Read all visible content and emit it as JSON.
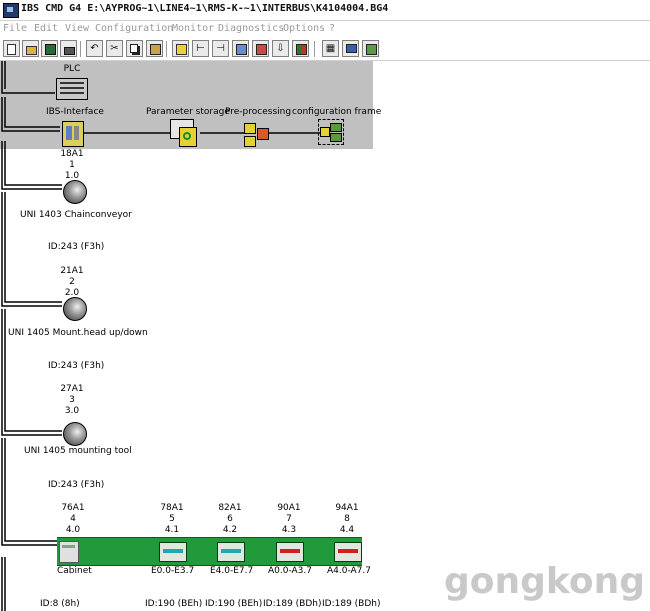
{
  "window": {
    "title": "IBS CMD G4 E:\\AYPROG~1\\LINE4~1\\RMS-K-~1\\INTERBUS\\K4104004.BG4"
  },
  "menu": [
    "File",
    "Edit",
    "View",
    "Configuration",
    "Monitor",
    "Diagnostics",
    "Options",
    "?"
  ],
  "toolbar": {
    "buttons": [
      "new-file-icon",
      "open-folder-icon",
      "save-icon",
      "print-icon",
      "undo-icon",
      "cut-icon",
      "copy-icon",
      "paste-icon",
      "bus-connect-icon",
      "add-device-icon",
      "add-branch-icon",
      "replace-icon",
      "swap-icon",
      "download-icon",
      "signal-icon",
      "table-icon",
      "monitor-icon",
      "tree-icon"
    ]
  },
  "diagram": {
    "plc_label": "PLC",
    "interface_label": "IBS-Interface",
    "param_storage_label": "Parameter storage",
    "preprocessing_label": "Pre-processing",
    "config_frame_label": "configuration frame",
    "devices": [
      {
        "addr": "18A1",
        "num": "1",
        "pos": "1.0",
        "name": "UNI 1403 Chainconveyor",
        "id": "ID:243 (F3h)"
      },
      {
        "addr": "21A1",
        "num": "2",
        "pos": "2.0",
        "name": "UNI 1405  Mount.head up/down",
        "id": "ID:243 (F3h)"
      },
      {
        "addr": "27A1",
        "num": "3",
        "pos": "3.0",
        "name": "UNI 1405  mounting tool",
        "id": "ID:243 (F3h)"
      }
    ],
    "cabinet": {
      "head": {
        "addr": "76A1",
        "num": "4",
        "pos": "4.0",
        "name": "Cabinet",
        "id": "ID:8 (8h)"
      },
      "modules": [
        {
          "addr": "78A1",
          "num": "5",
          "pos": "4.1",
          "range": "E0.0-E3.7",
          "id": "ID:190 (BEh)",
          "color": "#1fa6b0"
        },
        {
          "addr": "82A1",
          "num": "6",
          "pos": "4.2",
          "range": "E4.0-E7.7",
          "id": "ID:190 (BEh)",
          "color": "#1fa6b0"
        },
        {
          "addr": "90A1",
          "num": "7",
          "pos": "4.3",
          "range": "A0.0-A3.7",
          "id": "ID:189 (BDh)",
          "color": "#d02020"
        },
        {
          "addr": "94A1",
          "num": "8",
          "pos": "4.4",
          "range": "A4.0-A7.7",
          "id": "ID:189 (BDh)",
          "color": "#d02020"
        }
      ]
    }
  },
  "watermark": "gongkong",
  "colors": {
    "gray_panel": "#c0c0c0",
    "bus_green": "#209a3a"
  }
}
